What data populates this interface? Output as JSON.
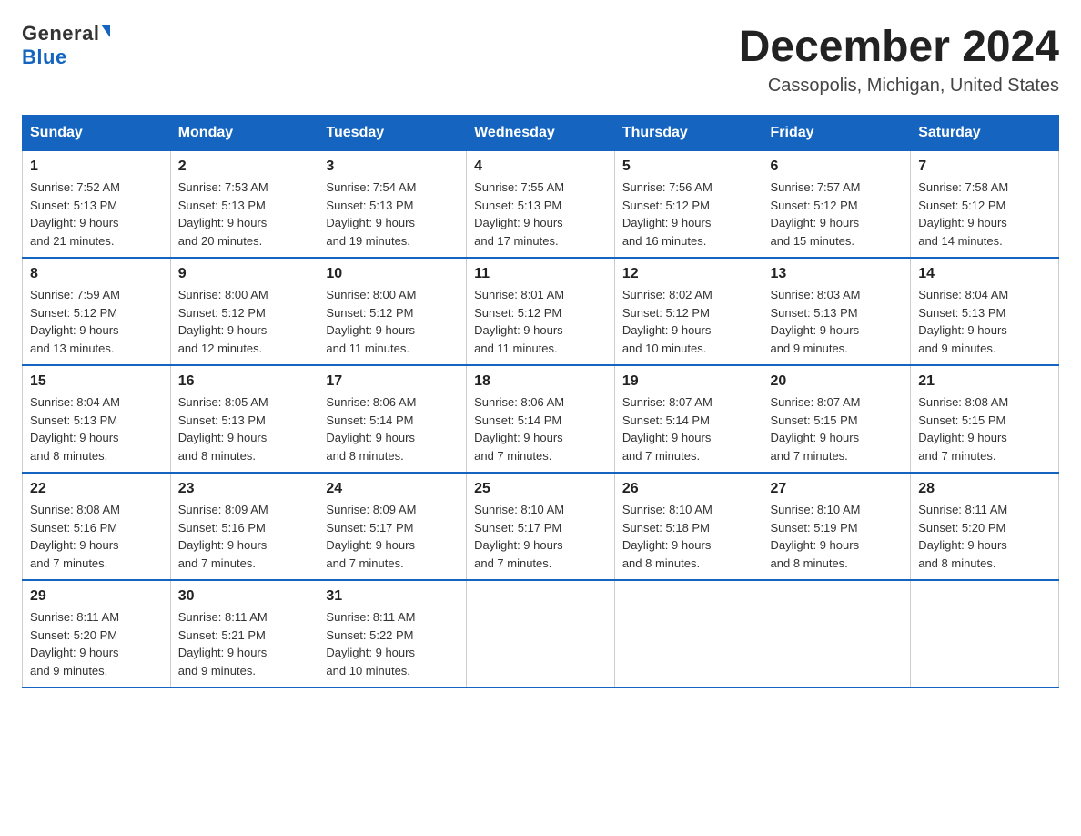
{
  "logo": {
    "general": "General",
    "blue": "Blue"
  },
  "title": "December 2024",
  "location": "Cassopolis, Michigan, United States",
  "days_of_week": [
    "Sunday",
    "Monday",
    "Tuesday",
    "Wednesday",
    "Thursday",
    "Friday",
    "Saturday"
  ],
  "weeks": [
    [
      {
        "day": "1",
        "sunrise": "7:52 AM",
        "sunset": "5:13 PM",
        "daylight": "9 hours and 21 minutes."
      },
      {
        "day": "2",
        "sunrise": "7:53 AM",
        "sunset": "5:13 PM",
        "daylight": "9 hours and 20 minutes."
      },
      {
        "day": "3",
        "sunrise": "7:54 AM",
        "sunset": "5:13 PM",
        "daylight": "9 hours and 19 minutes."
      },
      {
        "day": "4",
        "sunrise": "7:55 AM",
        "sunset": "5:13 PM",
        "daylight": "9 hours and 17 minutes."
      },
      {
        "day": "5",
        "sunrise": "7:56 AM",
        "sunset": "5:12 PM",
        "daylight": "9 hours and 16 minutes."
      },
      {
        "day": "6",
        "sunrise": "7:57 AM",
        "sunset": "5:12 PM",
        "daylight": "9 hours and 15 minutes."
      },
      {
        "day": "7",
        "sunrise": "7:58 AM",
        "sunset": "5:12 PM",
        "daylight": "9 hours and 14 minutes."
      }
    ],
    [
      {
        "day": "8",
        "sunrise": "7:59 AM",
        "sunset": "5:12 PM",
        "daylight": "9 hours and 13 minutes."
      },
      {
        "day": "9",
        "sunrise": "8:00 AM",
        "sunset": "5:12 PM",
        "daylight": "9 hours and 12 minutes."
      },
      {
        "day": "10",
        "sunrise": "8:00 AM",
        "sunset": "5:12 PM",
        "daylight": "9 hours and 11 minutes."
      },
      {
        "day": "11",
        "sunrise": "8:01 AM",
        "sunset": "5:12 PM",
        "daylight": "9 hours and 11 minutes."
      },
      {
        "day": "12",
        "sunrise": "8:02 AM",
        "sunset": "5:12 PM",
        "daylight": "9 hours and 10 minutes."
      },
      {
        "day": "13",
        "sunrise": "8:03 AM",
        "sunset": "5:13 PM",
        "daylight": "9 hours and 9 minutes."
      },
      {
        "day": "14",
        "sunrise": "8:04 AM",
        "sunset": "5:13 PM",
        "daylight": "9 hours and 9 minutes."
      }
    ],
    [
      {
        "day": "15",
        "sunrise": "8:04 AM",
        "sunset": "5:13 PM",
        "daylight": "9 hours and 8 minutes."
      },
      {
        "day": "16",
        "sunrise": "8:05 AM",
        "sunset": "5:13 PM",
        "daylight": "9 hours and 8 minutes."
      },
      {
        "day": "17",
        "sunrise": "8:06 AM",
        "sunset": "5:14 PM",
        "daylight": "9 hours and 8 minutes."
      },
      {
        "day": "18",
        "sunrise": "8:06 AM",
        "sunset": "5:14 PM",
        "daylight": "9 hours and 7 minutes."
      },
      {
        "day": "19",
        "sunrise": "8:07 AM",
        "sunset": "5:14 PM",
        "daylight": "9 hours and 7 minutes."
      },
      {
        "day": "20",
        "sunrise": "8:07 AM",
        "sunset": "5:15 PM",
        "daylight": "9 hours and 7 minutes."
      },
      {
        "day": "21",
        "sunrise": "8:08 AM",
        "sunset": "5:15 PM",
        "daylight": "9 hours and 7 minutes."
      }
    ],
    [
      {
        "day": "22",
        "sunrise": "8:08 AM",
        "sunset": "5:16 PM",
        "daylight": "9 hours and 7 minutes."
      },
      {
        "day": "23",
        "sunrise": "8:09 AM",
        "sunset": "5:16 PM",
        "daylight": "9 hours and 7 minutes."
      },
      {
        "day": "24",
        "sunrise": "8:09 AM",
        "sunset": "5:17 PM",
        "daylight": "9 hours and 7 minutes."
      },
      {
        "day": "25",
        "sunrise": "8:10 AM",
        "sunset": "5:17 PM",
        "daylight": "9 hours and 7 minutes."
      },
      {
        "day": "26",
        "sunrise": "8:10 AM",
        "sunset": "5:18 PM",
        "daylight": "9 hours and 8 minutes."
      },
      {
        "day": "27",
        "sunrise": "8:10 AM",
        "sunset": "5:19 PM",
        "daylight": "9 hours and 8 minutes."
      },
      {
        "day": "28",
        "sunrise": "8:11 AM",
        "sunset": "5:20 PM",
        "daylight": "9 hours and 8 minutes."
      }
    ],
    [
      {
        "day": "29",
        "sunrise": "8:11 AM",
        "sunset": "5:20 PM",
        "daylight": "9 hours and 9 minutes."
      },
      {
        "day": "30",
        "sunrise": "8:11 AM",
        "sunset": "5:21 PM",
        "daylight": "9 hours and 9 minutes."
      },
      {
        "day": "31",
        "sunrise": "8:11 AM",
        "sunset": "5:22 PM",
        "daylight": "9 hours and 10 minutes."
      },
      null,
      null,
      null,
      null
    ]
  ],
  "labels": {
    "sunrise": "Sunrise:",
    "sunset": "Sunset:",
    "daylight": "Daylight:"
  }
}
